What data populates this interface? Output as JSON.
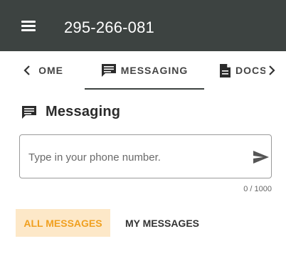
{
  "header": {
    "title": "295-266-081",
    "background": "#3d4341",
    "menu_icon": "hamburger-icon"
  },
  "tabs": {
    "home_label": "HOME",
    "messaging_label": "MESSAGING",
    "messaging_icon": "chat-bubble-icon",
    "docs_label": "DOCS",
    "docs_icon": "document-icon",
    "active": "MESSAGING",
    "prev_icon": "chevron-left-icon",
    "next_icon": "chevron-right-icon"
  },
  "messaging": {
    "section_title": "Messaging",
    "input_placeholder": "Type in your phone number.",
    "input_value": "",
    "char_counter": "0 / 1000",
    "send_icon": "send-icon"
  },
  "filters": {
    "all_label": "ALL MESSAGES",
    "mine_label": "MY MESSAGES",
    "active": "ALL MESSAGES",
    "accent": "#f0a020",
    "accent_bg": "#fde8c8"
  }
}
